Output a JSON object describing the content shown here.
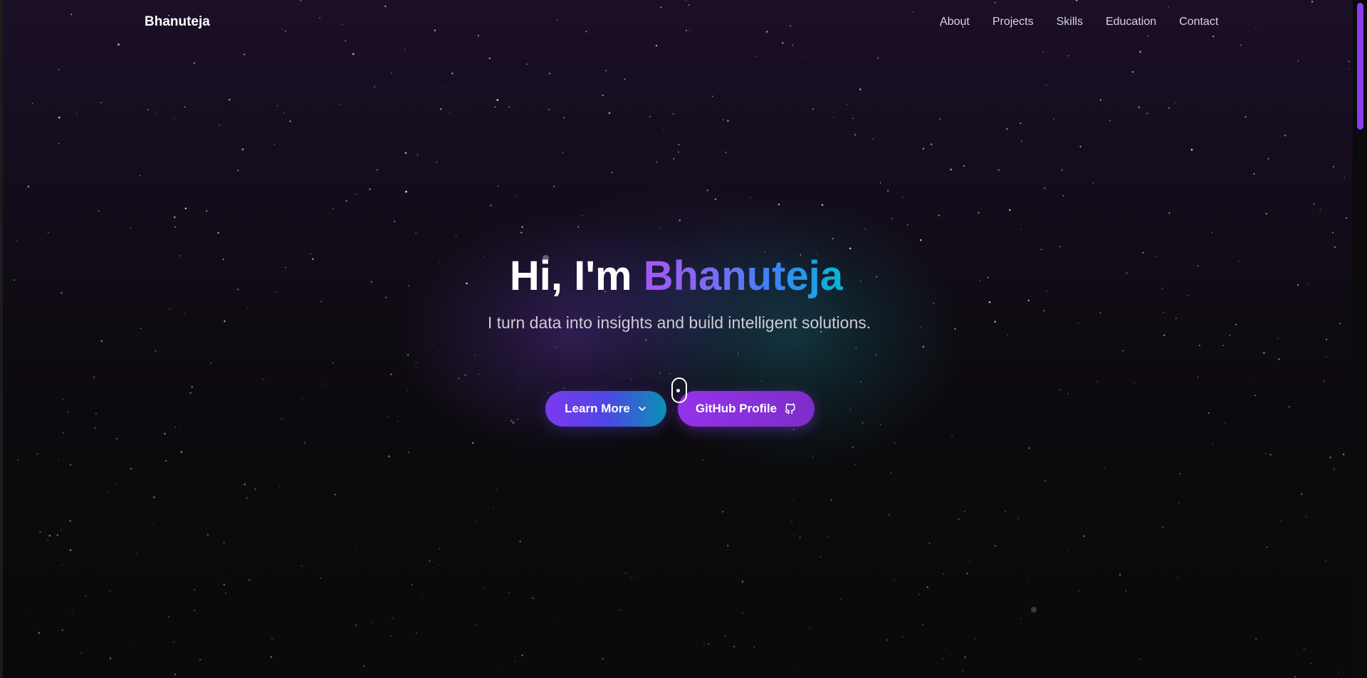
{
  "nav": {
    "brand": "Bhanuteja",
    "links": [
      "About",
      "Projects",
      "Skills",
      "Education",
      "Contact"
    ]
  },
  "hero": {
    "greeting": "Hi, I'm",
    "name": "Bhanuteja",
    "subtitle": "I turn data into insights and build intelligent solutions."
  },
  "buttons": {
    "learn_more": "Learn More",
    "github": "GitHub Profile"
  },
  "icons": {
    "learn_more_icon": "chevron-down-icon",
    "github_icon": "github-icon",
    "scroll_indicator": "mouse-scroll-icon"
  },
  "colors": {
    "accent_purple": "#9333ea",
    "accent_cyan": "#06b6d4",
    "scrollbar": "#8b3df0",
    "background": "#0a0a0b"
  }
}
